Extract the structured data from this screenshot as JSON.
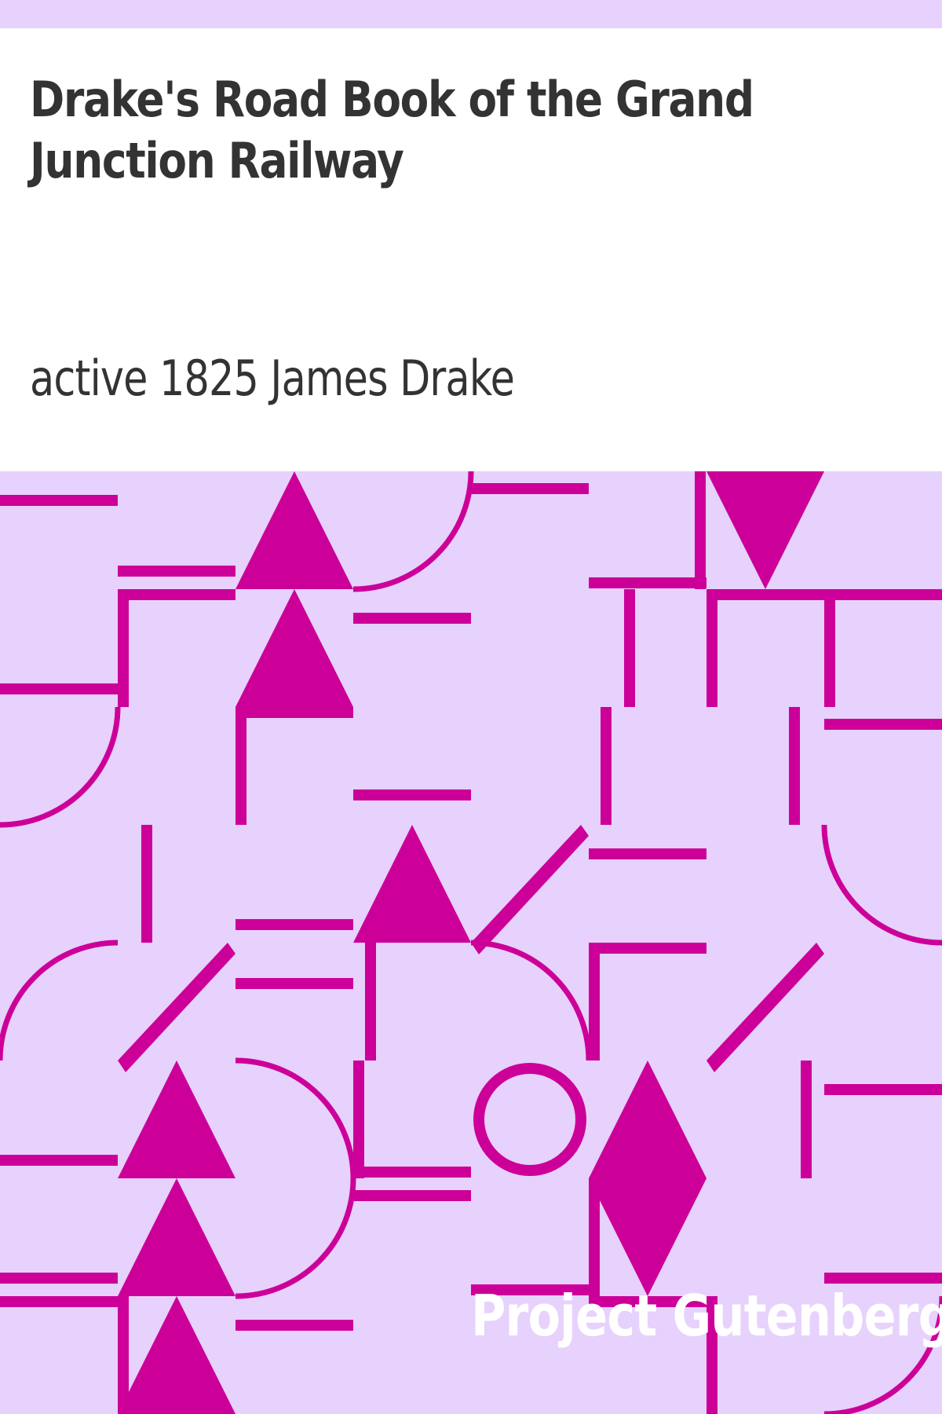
{
  "book": {
    "title": "Drake's Road Book of the Grand Junction Railway",
    "author": "active 1825 James Drake",
    "publisher": "Project Gutenberg"
  },
  "colors": {
    "background": "#e6d2fc",
    "pattern": "#cc0099",
    "title_panel": "#ffffff",
    "text": "#333333",
    "publisher_text": "#ffffff"
  }
}
